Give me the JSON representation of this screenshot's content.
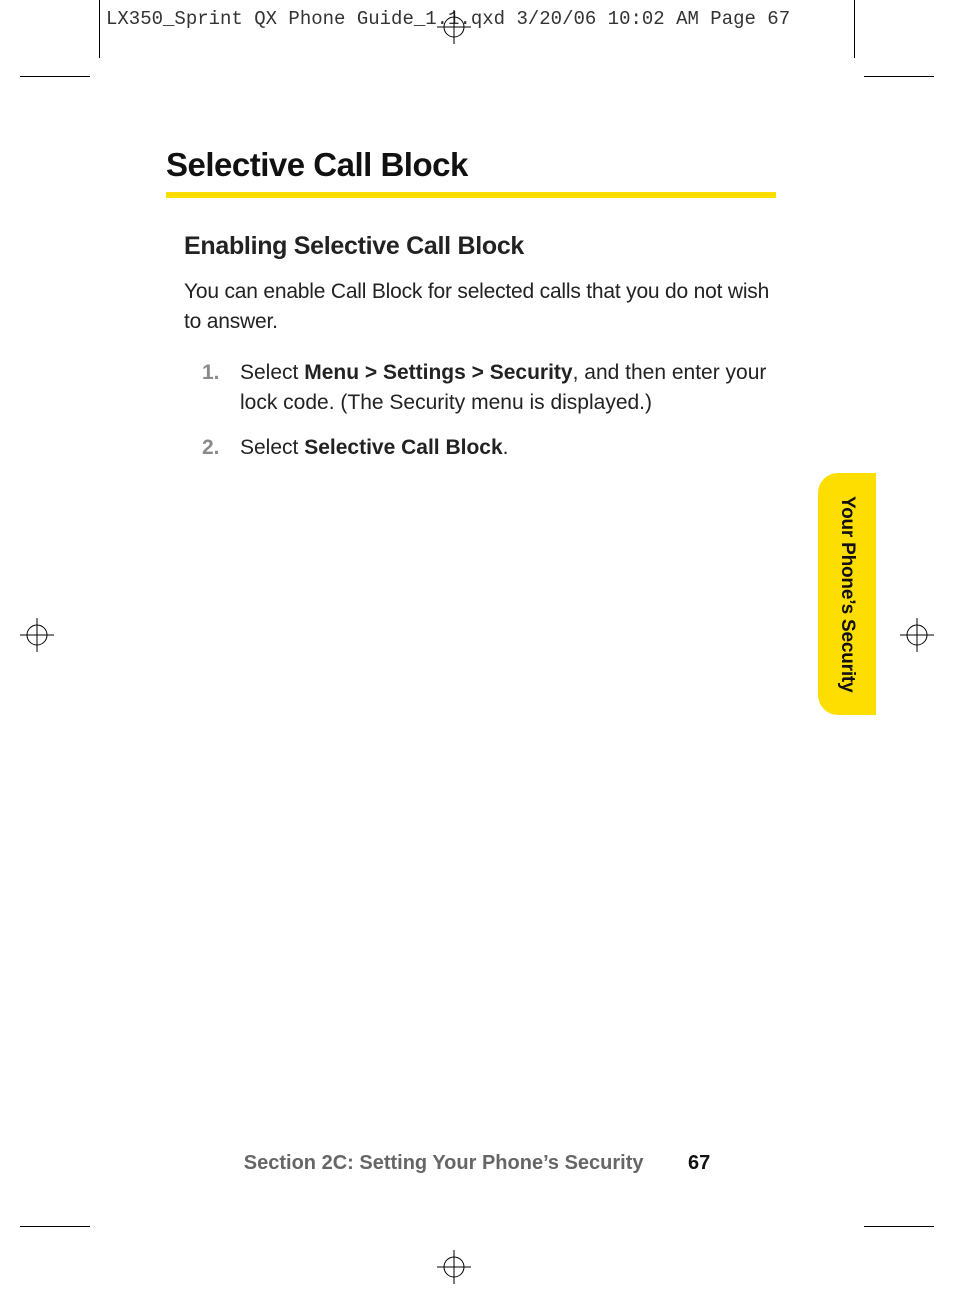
{
  "slug": "LX350_Sprint QX Phone Guide_1.1.qxd  3/20/06  10:02 AM  Page 67",
  "title": "Selective Call Block",
  "subtitle": "Enabling Selective Call Block",
  "intro": "You can enable Call Block for selected calls that you do not wish to answer.",
  "steps": {
    "0": {
      "num": "1.",
      "pre": "Select ",
      "bold": "Menu > Settings > Security",
      "post": ", and then enter your lock code. (The Security menu is displayed.)"
    },
    "1": {
      "num": "2.",
      "pre": "Select ",
      "bold": "Selective Call Block",
      "post": "."
    }
  },
  "side_tab": "Your Phone’s Security",
  "footer": {
    "section": "Section 2C: Setting Your Phone’s Security",
    "page": "67"
  },
  "colors": {
    "accent": "#fedd00",
    "step_num": "#8a8a8a",
    "footer_muted": "#666666"
  }
}
